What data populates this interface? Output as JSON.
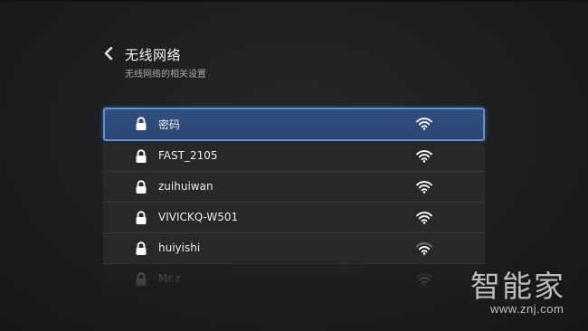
{
  "header": {
    "title": "无线网络",
    "subtitle": "无线网络的相关设置",
    "back_icon": "chevron-left-icon"
  },
  "networks": [
    {
      "ssid": "密码",
      "locked": true,
      "signal": "strong",
      "selected": true
    },
    {
      "ssid": "FAST_2105",
      "locked": true,
      "signal": "strong",
      "selected": false
    },
    {
      "ssid": "zuihuiwan",
      "locked": true,
      "signal": "strong",
      "selected": false
    },
    {
      "ssid": "VIVICKQ-W501",
      "locked": true,
      "signal": "strong",
      "selected": false
    },
    {
      "ssid": "huiyishi",
      "locked": true,
      "signal": "medium",
      "selected": false
    },
    {
      "ssid": "Mr.z",
      "locked": true,
      "signal": "medium",
      "selected": false
    }
  ],
  "watermark": {
    "logo": "智能家",
    "url": "www.znj.com"
  },
  "colors": {
    "background": "#1e1e20",
    "row": "#28282a",
    "selected": "#2f4f80",
    "selected_border": "#5f8fd6",
    "text": "#ededed"
  }
}
